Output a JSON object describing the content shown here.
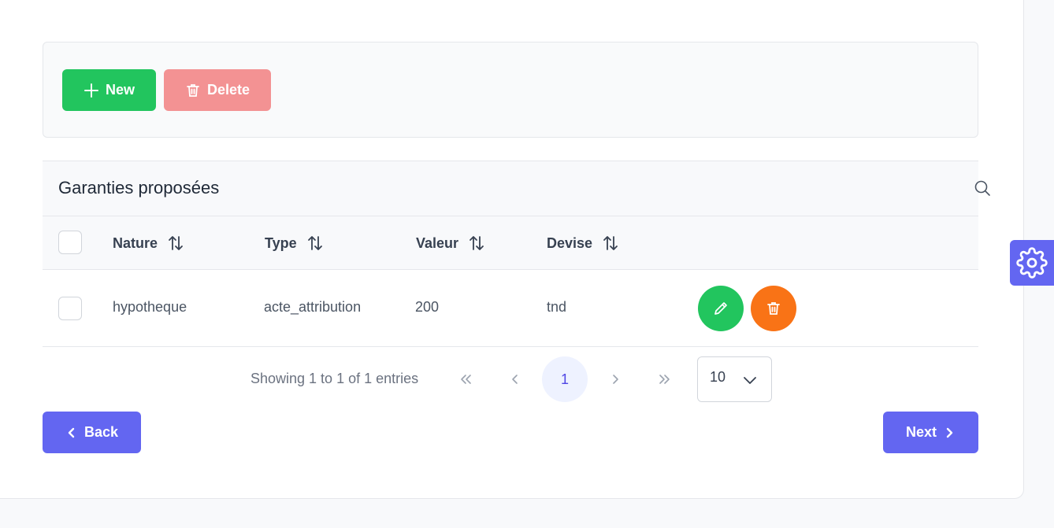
{
  "toolbar": {
    "new_label": "New",
    "delete_label": "Delete"
  },
  "table": {
    "title": "Garanties proposées",
    "columns": [
      "Nature",
      "Type",
      "Valeur",
      "Devise"
    ],
    "rows": [
      {
        "nature": "hypotheque",
        "type": "acte_attribution",
        "valeur": "200",
        "devise": "tnd"
      }
    ]
  },
  "pagination": {
    "summary": "Showing 1 to 1 of 1 entries",
    "current_page": "1",
    "rows_per_page": "10"
  },
  "nav": {
    "back_label": "Back",
    "next_label": "Next"
  },
  "colors": {
    "success": "#22c55e",
    "danger_soft": "#f39293",
    "warning": "#f97316",
    "primary": "#6366f1"
  },
  "icons": [
    "plus-icon",
    "trash-icon",
    "search-icon",
    "sort-icon",
    "pencil-icon",
    "chevrons-left-icon",
    "chevron-left-icon",
    "chevron-right-icon",
    "chevrons-right-icon",
    "chevron-down-icon",
    "gear-icon"
  ]
}
